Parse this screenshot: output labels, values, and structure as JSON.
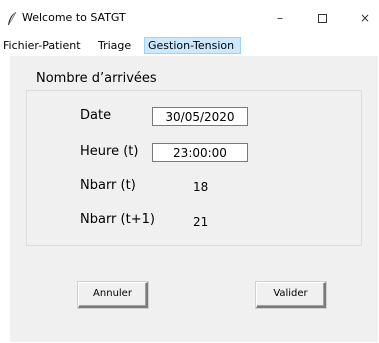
{
  "window": {
    "title": "Welcome to SATGT",
    "minimize_glyph": "–",
    "close_glyph": "×"
  },
  "menu": {
    "items": [
      {
        "label": "Fichier-Patient"
      },
      {
        "label": "Triage"
      },
      {
        "label": "Gestion-Tension",
        "active": true
      }
    ]
  },
  "form": {
    "group_title": "Nombre d’arrivées",
    "date_label": "Date",
    "date_value": "30/05/2020",
    "hour_label": "Heure (t)",
    "hour_value": "23:00:00",
    "nbarr_t_label": "Nbarr (t)",
    "nbarr_t_value": "18",
    "nbarr_t1_label": "Nbarr (t+1)",
    "nbarr_t1_value": "21"
  },
  "buttons": {
    "cancel_label": "Annuler",
    "validate_label": "Valider"
  },
  "colors": {
    "menu_active_bg": "#cce8ff",
    "content_bg": "#f0f0f0"
  },
  "icons": {
    "app_icon": "feather-icon",
    "minimize": "minimize-icon",
    "maximize": "maximize-icon",
    "close": "close-icon"
  }
}
